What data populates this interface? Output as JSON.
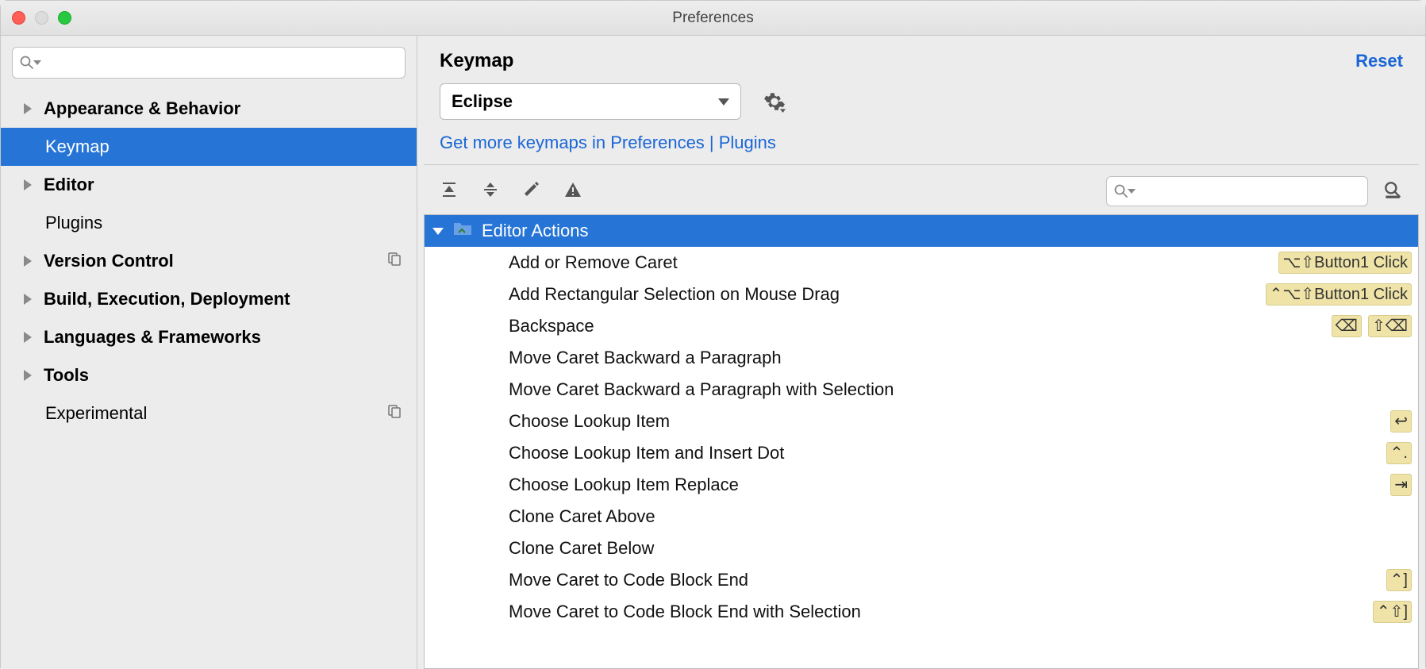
{
  "window": {
    "title": "Preferences"
  },
  "sidebar": {
    "search_placeholder": "",
    "items": [
      {
        "label": "Appearance & Behavior",
        "expandable": true
      },
      {
        "label": "Keymap"
      },
      {
        "label": "Editor",
        "expandable": true
      },
      {
        "label": "Plugins"
      },
      {
        "label": "Version Control",
        "expandable": true,
        "trailing": "copy"
      },
      {
        "label": "Build, Execution, Deployment",
        "expandable": true
      },
      {
        "label": "Languages & Frameworks",
        "expandable": true
      },
      {
        "label": "Tools",
        "expandable": true
      },
      {
        "label": "Experimental",
        "trailing": "copy"
      }
    ]
  },
  "content": {
    "title": "Keymap",
    "reset": "Reset",
    "scheme": "Eclipse",
    "plugins_link": "Get more keymaps in Preferences | Plugins",
    "group": "Editor Actions",
    "actions": [
      {
        "label": "Add or Remove Caret",
        "shortcuts": [
          "⌥⇧Button1 Click"
        ]
      },
      {
        "label": "Add Rectangular Selection on Mouse Drag",
        "shortcuts": [
          "⌃⌥⇧Button1 Click"
        ]
      },
      {
        "label": "Backspace",
        "shortcuts": [
          "⌫",
          "⇧⌫"
        ]
      },
      {
        "label": "Move Caret Backward a Paragraph",
        "shortcuts": []
      },
      {
        "label": "Move Caret Backward a Paragraph with Selection",
        "shortcuts": []
      },
      {
        "label": "Choose Lookup Item",
        "shortcuts": [
          "↩"
        ]
      },
      {
        "label": "Choose Lookup Item and Insert Dot",
        "shortcuts": [
          "⌃."
        ]
      },
      {
        "label": "Choose Lookup Item Replace",
        "shortcuts": [
          "⇥"
        ]
      },
      {
        "label": "Clone Caret Above",
        "shortcuts": []
      },
      {
        "label": "Clone Caret Below",
        "shortcuts": []
      },
      {
        "label": "Move Caret to Code Block End",
        "shortcuts": [
          "⌃]"
        ]
      },
      {
        "label": "Move Caret to Code Block End with Selection",
        "shortcuts": [
          "⌃⇧]"
        ]
      }
    ]
  }
}
